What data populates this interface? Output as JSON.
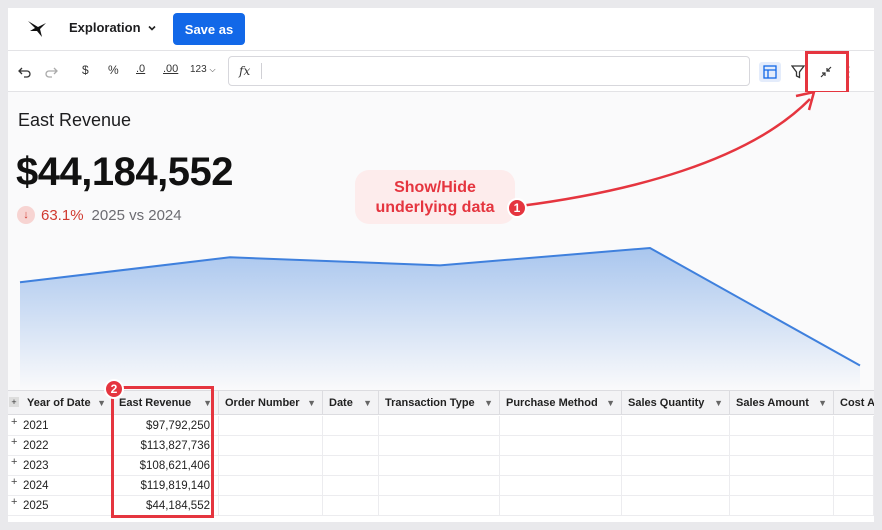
{
  "header": {
    "workbook_title": "Exploration",
    "save_label": "Save as"
  },
  "toolbar": {
    "currency": "$",
    "percent": "%",
    "decrease_decimals": ".0",
    "increase_decimals": ".00",
    "number_format": "123",
    "fx": "fx"
  },
  "kpi": {
    "title": "East Revenue",
    "value": "$44,184,552",
    "delta_pct": "63.1%",
    "comparison": "2025 vs 2024"
  },
  "chart_data": {
    "type": "area",
    "x": [
      "2021",
      "2022",
      "2023",
      "2024",
      "2025"
    ],
    "series": [
      {
        "values": [
          97792250,
          113827736,
          108621406,
          119819140,
          44184552
        ]
      }
    ],
    "fill_color": "#a9c6ee",
    "line_color": "#3f80dd"
  },
  "annotation": {
    "line1": "Show/Hide",
    "line2": "underlying data",
    "marker1": "1",
    "marker2": "2"
  },
  "table": {
    "columns": [
      "Year of Date",
      "East Revenue",
      "Order Number",
      "Date",
      "Transaction Type",
      "Purchase Method",
      "Sales Quantity",
      "Sales Amount",
      "Cost A"
    ],
    "rows": [
      {
        "year": "2021",
        "revenue": "$97,792,250"
      },
      {
        "year": "2022",
        "revenue": "$113,827,736"
      },
      {
        "year": "2023",
        "revenue": "$108,621,406"
      },
      {
        "year": "2024",
        "revenue": "$119,819,140"
      },
      {
        "year": "2025",
        "revenue": "$44,184,552"
      }
    ]
  },
  "colors": {
    "accent": "#1268e8",
    "annotation_red": "#e5353f",
    "negative": "#d03a30"
  }
}
